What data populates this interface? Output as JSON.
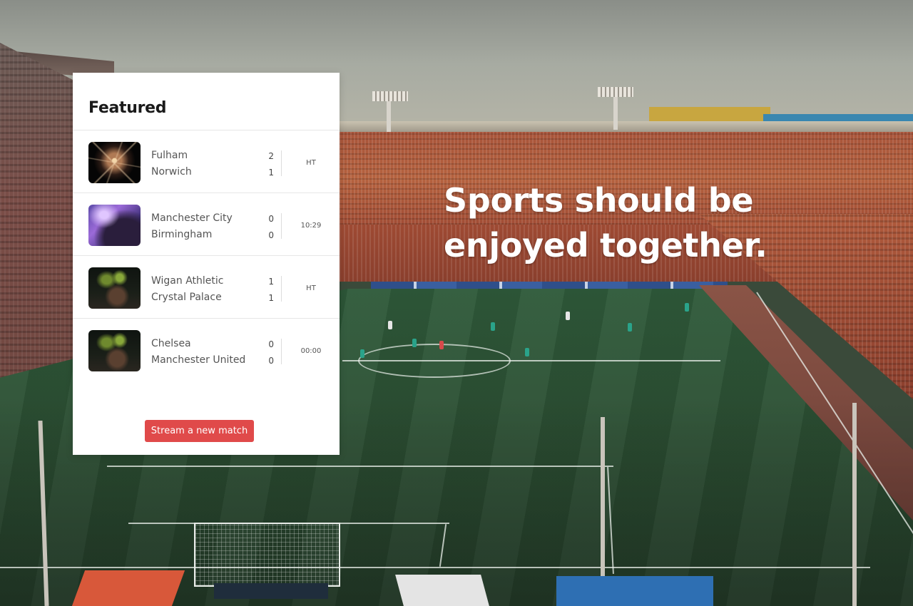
{
  "featured": {
    "title": "Featured",
    "matches": [
      {
        "home_team": "Fulham",
        "away_team": "Norwich",
        "home_score": "2",
        "away_score": "1",
        "status": "HT",
        "thumbnail": "firework-image"
      },
      {
        "home_team": "Manchester City",
        "away_team": "Birmingham",
        "home_score": "0",
        "away_score": "0",
        "status": "10:29",
        "thumbnail": "concert-image"
      },
      {
        "home_team": "Wigan Athletic",
        "away_team": "Crystal Palace",
        "home_score": "1",
        "away_score": "1",
        "status": "HT",
        "thumbnail": "cake-image"
      },
      {
        "home_team": "Chelsea",
        "away_team": "Manchester United",
        "home_score": "0",
        "away_score": "0",
        "status": "00:00",
        "thumbnail": "cake-image"
      }
    ],
    "stream_button_label": "Stream a new match"
  },
  "hero": {
    "headline_line1": "Sports should be",
    "headline_line2": "enjoyed together."
  },
  "colors": {
    "accent": "#e04a4a",
    "card_background": "#ffffff",
    "headline_text": "#ffffff"
  }
}
